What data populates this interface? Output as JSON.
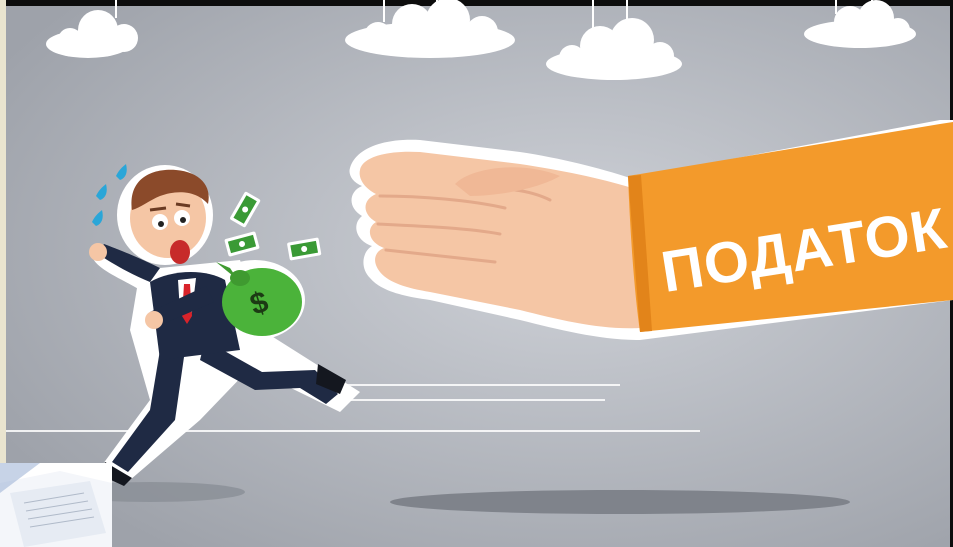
{
  "illustration": {
    "sleeve_text": "ПОДАТОК",
    "money_bag_symbol": "$",
    "colors": {
      "background": "#b9bcc3",
      "sleeve": "#f39a2b",
      "money_bag": "#4bb33a",
      "suit": "#1f2a44",
      "skin": "#f5c6a5"
    }
  }
}
